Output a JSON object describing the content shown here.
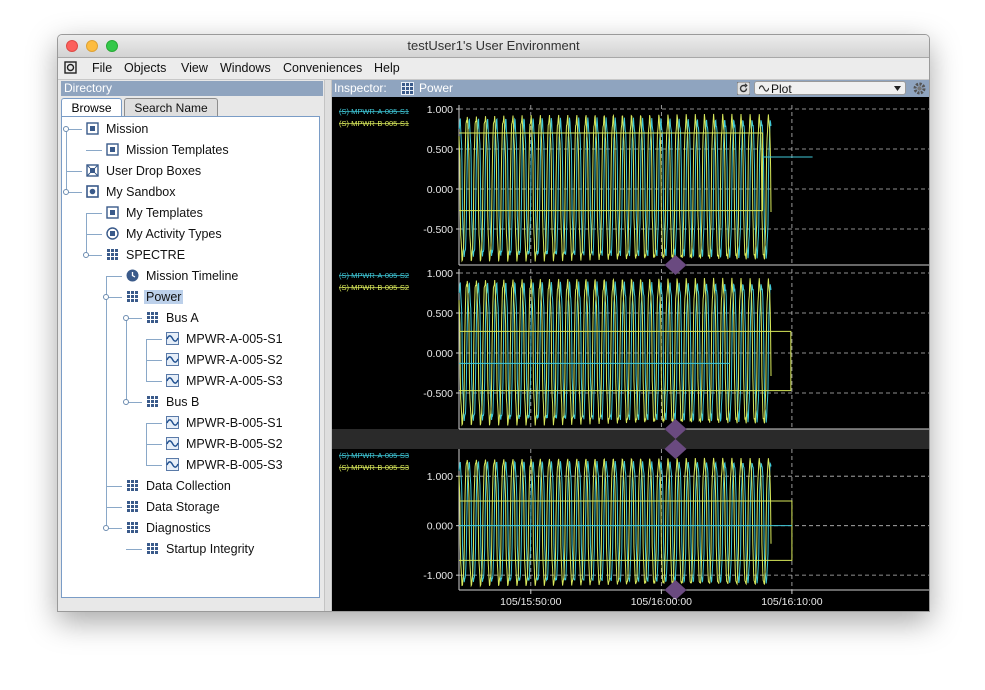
{
  "window": {
    "title": "testUser1's User Environment"
  },
  "menu": {
    "items": [
      "File",
      "Objects",
      "View",
      "Windows",
      "Conveniences",
      "Help"
    ]
  },
  "directory": {
    "header": "Directory",
    "tabs": {
      "browse": "Browse",
      "search": "Search Name"
    },
    "tree": [
      {
        "label": "Mission",
        "icon": "mission-icon",
        "depth": 0,
        "expanded": true
      },
      {
        "label": "Mission Templates",
        "icon": "template-icon",
        "depth": 1
      },
      {
        "label": "User Drop Boxes",
        "icon": "dropbox-icon",
        "depth": 0
      },
      {
        "label": "My Sandbox",
        "icon": "sandbox-icon",
        "depth": 0,
        "expanded": true
      },
      {
        "label": "My Templates",
        "icon": "template-icon",
        "depth": 1
      },
      {
        "label": "My Activity Types",
        "icon": "activity-type-icon",
        "depth": 1
      },
      {
        "label": "SPECTRE",
        "icon": "grid-icon",
        "depth": 1,
        "expanded": true
      },
      {
        "label": "Mission Timeline",
        "icon": "clock-icon",
        "depth": 2
      },
      {
        "label": "Power",
        "icon": "grid-icon",
        "depth": 2,
        "expanded": true,
        "selected": true
      },
      {
        "label": "Bus A",
        "icon": "grid-icon",
        "depth": 3,
        "expanded": true
      },
      {
        "label": "MPWR-A-005-S1",
        "icon": "signal-icon",
        "depth": 4
      },
      {
        "label": "MPWR-A-005-S2",
        "icon": "signal-icon",
        "depth": 4
      },
      {
        "label": "MPWR-A-005-S3",
        "icon": "signal-icon",
        "depth": 4
      },
      {
        "label": "Bus B",
        "icon": "grid-icon",
        "depth": 3,
        "expanded": true
      },
      {
        "label": "MPWR-B-005-S1",
        "icon": "signal-icon",
        "depth": 4
      },
      {
        "label": "MPWR-B-005-S2",
        "icon": "signal-icon",
        "depth": 4
      },
      {
        "label": "MPWR-B-005-S3",
        "icon": "signal-icon",
        "depth": 4
      },
      {
        "label": "Data Collection",
        "icon": "grid-icon",
        "depth": 2
      },
      {
        "label": "Data Storage",
        "icon": "grid-icon",
        "depth": 2
      },
      {
        "label": "Diagnostics",
        "icon": "grid-icon",
        "depth": 2,
        "expanded": true
      },
      {
        "label": "Startup Integrity",
        "icon": "grid-icon",
        "depth": 3
      }
    ]
  },
  "inspector": {
    "label": "Inspector:",
    "object": "Power",
    "view_select": "Plot"
  },
  "colors": {
    "series_a": "#3fc8d8",
    "series_b": "#d8e85a",
    "marker": "#6a4a80",
    "grid": "#bdbdbd"
  },
  "chart_data": [
    {
      "type": "line",
      "legend": [
        "(S) MPWR-A-005-S1",
        "(S) MPWR-B-005-S1"
      ],
      "yticks": [
        "1.000",
        "0.500",
        "0.000",
        "-0.500"
      ],
      "ylim": [
        -0.95,
        1.05
      ],
      "xlim": [
        "105/15:44:30",
        "105/16:20:30"
      ],
      "series": [
        {
          "name": "(S) MPWR-A-005-S1",
          "color": "#3fc8d8",
          "form": "oscillating sinusoid, amplitude 0.9, ~42 s period, ends ~105/16:13:40"
        },
        {
          "name": "(S) MPWR-B-005-S1",
          "color": "#d8e85a",
          "form": "oscillating sinusoid with step to 0.7 then -0.27 bands, ends ~105/16:13:40"
        }
      ]
    },
    {
      "type": "line",
      "legend": [
        "(S) MPWR-A-005-S2",
        "(S) MPWR-B-005-S2"
      ],
      "yticks": [
        "1.000",
        "0.500",
        "0.000",
        "-0.500"
      ],
      "ylim": [
        -0.95,
        1.05
      ],
      "xlim": [
        "105/15:44:30",
        "105/16:20:30"
      ],
      "series": [
        {
          "name": "(S) MPWR-A-005-S2",
          "color": "#3fc8d8",
          "form": "oscillating sinusoid near -0.47 baseline"
        },
        {
          "name": "(S) MPWR-B-005-S2",
          "color": "#d8e85a",
          "form": "oscillating sinusoid with bands at 0.27 and -0.13"
        }
      ]
    },
    {
      "type": "line",
      "legend": [
        "(S) MPWR-A-005-S3",
        "(S) MPWR-B-005-S3"
      ],
      "yticks": [
        "1.000",
        "0.000",
        "-1.000"
      ],
      "ylim": [
        -1.3,
        1.55
      ],
      "xlim": [
        "105/15:44:30",
        "105/16:20:30"
      ],
      "xticks": [
        "105/15:50:00",
        "105/16:00:00",
        "105/16:10:00"
      ],
      "series": [
        {
          "name": "(S) MPWR-A-005-S3",
          "color": "#3fc8d8",
          "form": "oscillating sinusoid, amplitude 1.3"
        },
        {
          "name": "(S) MPWR-B-005-S3",
          "color": "#d8e85a",
          "form": "oscillating sinusoid with bands at 0.5 and -0.7"
        }
      ]
    }
  ]
}
